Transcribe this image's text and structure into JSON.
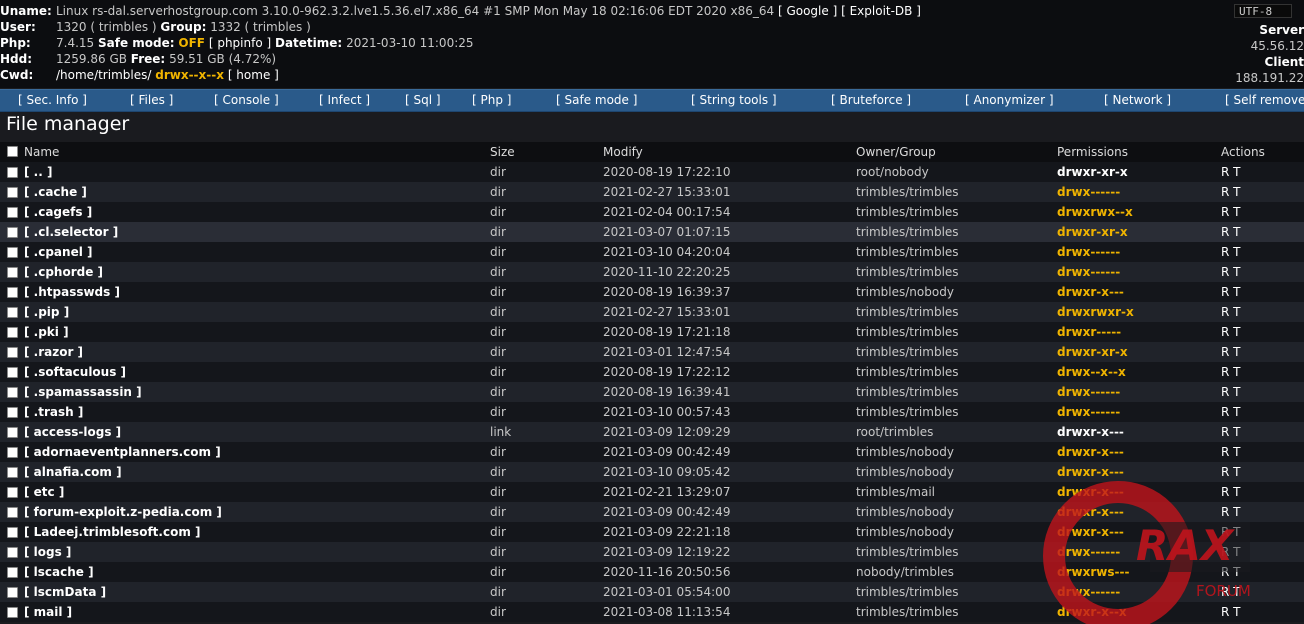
{
  "info": {
    "uname_label": "Uname:",
    "uname_value": "Linux rs-dal.serverhostgroup.com 3.10.0-962.3.2.lve1.5.36.el7.x86_64 #1 SMP Mon May 18 02:16:06 EDT 2020 x86_64",
    "google": "[ Google ]",
    "exploitdb": "[ Exploit-DB ]",
    "user_label": "User:",
    "user_value": "1320 ( trimbles )",
    "group_label": "Group:",
    "group_value": "1332 ( trimbles )",
    "php_label": "Php:",
    "php_value": "7.4.15",
    "safe_mode_label": "Safe mode:",
    "safe_mode_value": "OFF",
    "phpinfo": "[ phpinfo ]",
    "datetime_label": "Datetime:",
    "datetime_value": "2021-03-10 11:00:25",
    "hdd_label": "Hdd:",
    "hdd_value": "1259.86 GB",
    "free_label": "Free:",
    "free_value": "59.51 GB (4.72%)",
    "cwd_label": "Cwd:",
    "cwd_value": "/home/trimbles/",
    "cwd_perm": "drwx--x--x",
    "cwd_home": "[ home ]",
    "charset": "UTF-8",
    "server_label": "Server",
    "server_ip": "45.56.12",
    "client_label": "Client",
    "client_ip": "188.191.22"
  },
  "menu": [
    "[ Sec. Info ]",
    "[ Files ]",
    "[ Console ]",
    "[ Infect ]",
    "[ Sql ]",
    "[ Php ]",
    "[ Safe mode ]",
    "[ String tools ]",
    "[ Bruteforce ]",
    "[ Anonymizer ]",
    "[ Network ]",
    "[ Self remove ]"
  ],
  "title": "File manager",
  "columns": {
    "name": "Name",
    "size": "Size",
    "modify": "Modify",
    "owner": "Owner/Group",
    "perms": "Permissions",
    "actions": "Actions"
  },
  "rows": [
    {
      "name": "[ .. ]",
      "size": "dir",
      "modify": "2020-08-19 17:22:10",
      "owner": "root/nobody",
      "perms": "drwxr-xr-x",
      "perm_color": "white",
      "actions": "R T"
    },
    {
      "name": "[ .cache ]",
      "size": "dir",
      "modify": "2021-02-27 15:33:01",
      "owner": "trimbles/trimbles",
      "perms": "drwx------",
      "perm_color": "yellow",
      "actions": "R T"
    },
    {
      "name": "[ .cagefs ]",
      "size": "dir",
      "modify": "2021-02-04 00:17:54",
      "owner": "trimbles/trimbles",
      "perms": "drwxrwx--x",
      "perm_color": "yellow",
      "actions": "R T"
    },
    {
      "name": "[ .cl.selector ]",
      "size": "dir",
      "modify": "2021-03-07 01:07:15",
      "owner": "trimbles/trimbles",
      "perms": "drwxr-xr-x",
      "perm_color": "yellow",
      "actions": "R T"
    },
    {
      "name": "[ .cpanel ]",
      "size": "dir",
      "modify": "2021-03-10 04:20:04",
      "owner": "trimbles/trimbles",
      "perms": "drwx------",
      "perm_color": "yellow",
      "actions": "R T"
    },
    {
      "name": "[ .cphorde ]",
      "size": "dir",
      "modify": "2020-11-10 22:20:25",
      "owner": "trimbles/trimbles",
      "perms": "drwx------",
      "perm_color": "yellow",
      "actions": "R T"
    },
    {
      "name": "[ .htpasswds ]",
      "size": "dir",
      "modify": "2020-08-19 16:39:37",
      "owner": "trimbles/nobody",
      "perms": "drwxr-x---",
      "perm_color": "yellow",
      "actions": "R T"
    },
    {
      "name": "[ .pip ]",
      "size": "dir",
      "modify": "2021-02-27 15:33:01",
      "owner": "trimbles/trimbles",
      "perms": "drwxrwxr-x",
      "perm_color": "yellow",
      "actions": "R T"
    },
    {
      "name": "[ .pki ]",
      "size": "dir",
      "modify": "2020-08-19 17:21:18",
      "owner": "trimbles/trimbles",
      "perms": "drwxr-----",
      "perm_color": "yellow",
      "actions": "R T"
    },
    {
      "name": "[ .razor ]",
      "size": "dir",
      "modify": "2021-03-01 12:47:54",
      "owner": "trimbles/trimbles",
      "perms": "drwxr-xr-x",
      "perm_color": "yellow",
      "actions": "R T"
    },
    {
      "name": "[ .softaculous ]",
      "size": "dir",
      "modify": "2020-08-19 17:22:12",
      "owner": "trimbles/trimbles",
      "perms": "drwx--x--x",
      "perm_color": "yellow",
      "actions": "R T"
    },
    {
      "name": "[ .spamassassin ]",
      "size": "dir",
      "modify": "2020-08-19 16:39:41",
      "owner": "trimbles/trimbles",
      "perms": "drwx------",
      "perm_color": "yellow",
      "actions": "R T"
    },
    {
      "name": "[ .trash ]",
      "size": "dir",
      "modify": "2021-03-10 00:57:43",
      "owner": "trimbles/trimbles",
      "perms": "drwx------",
      "perm_color": "yellow",
      "actions": "R T"
    },
    {
      "name": "[ access-logs ]",
      "size": "link",
      "modify": "2021-03-09 12:09:29",
      "owner": "root/trimbles",
      "perms": "drwxr-x---",
      "perm_color": "white",
      "actions": "R T"
    },
    {
      "name": "[ adornaeventplanners.com ]",
      "size": "dir",
      "modify": "2021-03-09 00:42:49",
      "owner": "trimbles/nobody",
      "perms": "drwxr-x---",
      "perm_color": "yellow",
      "actions": "R T"
    },
    {
      "name": "[ alnafia.com ]",
      "size": "dir",
      "modify": "2021-03-10 09:05:42",
      "owner": "trimbles/nobody",
      "perms": "drwxr-x---",
      "perm_color": "yellow",
      "actions": "R T"
    },
    {
      "name": "[ etc ]",
      "size": "dir",
      "modify": "2021-02-21 13:29:07",
      "owner": "trimbles/mail",
      "perms": "drwxr-x---",
      "perm_color": "yellow",
      "actions": "R T"
    },
    {
      "name": "[ forum-exploit.z-pedia.com ]",
      "size": "dir",
      "modify": "2021-03-09 00:42:49",
      "owner": "trimbles/nobody",
      "perms": "drwxr-x---",
      "perm_color": "yellow",
      "actions": "R T"
    },
    {
      "name": "[ Ladeej.trimblesoft.com ]",
      "size": "dir",
      "modify": "2021-03-09 22:21:18",
      "owner": "trimbles/nobody",
      "perms": "drwxr-x---",
      "perm_color": "yellow",
      "actions": "R T"
    },
    {
      "name": "[ logs ]",
      "size": "dir",
      "modify": "2021-03-09 12:19:22",
      "owner": "trimbles/trimbles",
      "perms": "drwx------",
      "perm_color": "yellow",
      "actions": "R T"
    },
    {
      "name": "[ lscache ]",
      "size": "dir",
      "modify": "2020-11-16 20:50:56",
      "owner": "nobody/trimbles",
      "perms": "drwxrws---",
      "perm_color": "yellow",
      "actions": "R T"
    },
    {
      "name": "[ lscmData ]",
      "size": "dir",
      "modify": "2021-03-01 05:54:00",
      "owner": "trimbles/trimbles",
      "perms": "drwx------",
      "perm_color": "yellow",
      "actions": "R T"
    },
    {
      "name": "[ mail ]",
      "size": "dir",
      "modify": "2021-03-08 11:13:54",
      "owner": "trimbles/trimbles",
      "perms": "drwxr-x--x",
      "perm_color": "yellow",
      "actions": "R T"
    }
  ],
  "watermark_text": "RAX FORUM",
  "colors": {
    "accent_yellow": "#f0b400",
    "menu_blue": "#2a5a8a",
    "watermark_red": "#c0141c"
  }
}
